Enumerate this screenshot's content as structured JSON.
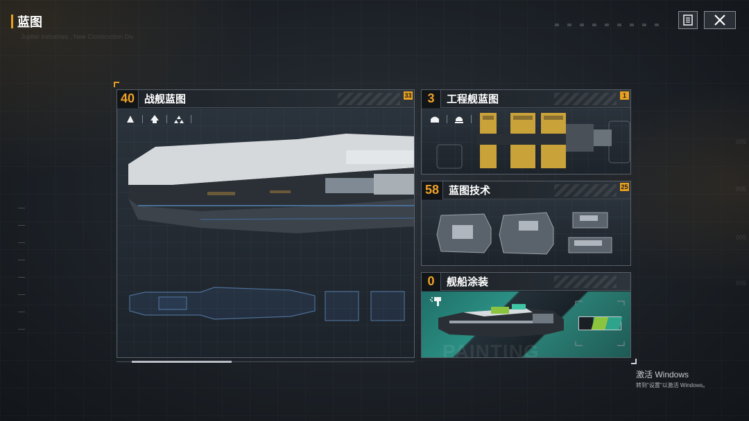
{
  "header": {
    "title": "蓝图",
    "subtitle": "Jupiter Industries , New Construction Div"
  },
  "toolbar": {
    "doc_icon": "document-icon",
    "close_icon": "close-icon"
  },
  "panels": {
    "battleship": {
      "count": "40",
      "title": "战舰蓝图",
      "badge": "33"
    },
    "engineering": {
      "count": "3",
      "title": "工程舰蓝图",
      "badge": "1"
    },
    "tech": {
      "count": "58",
      "title": "蓝图技术",
      "badge": "25"
    },
    "paint": {
      "count": "0",
      "title": "舰船涂装",
      "bg_text": "PAINTING"
    }
  },
  "side_labels": [
    "005",
    "005",
    "005",
    "005"
  ],
  "watermark": {
    "title": "激活 Windows",
    "subtitle": "转到\"设置\"以激活 Windows。"
  },
  "colors": {
    "accent": "#e8a020",
    "panel_border": "#58606a",
    "paint_teal": "#2fa48c",
    "paint_green": "#8bc43f"
  }
}
